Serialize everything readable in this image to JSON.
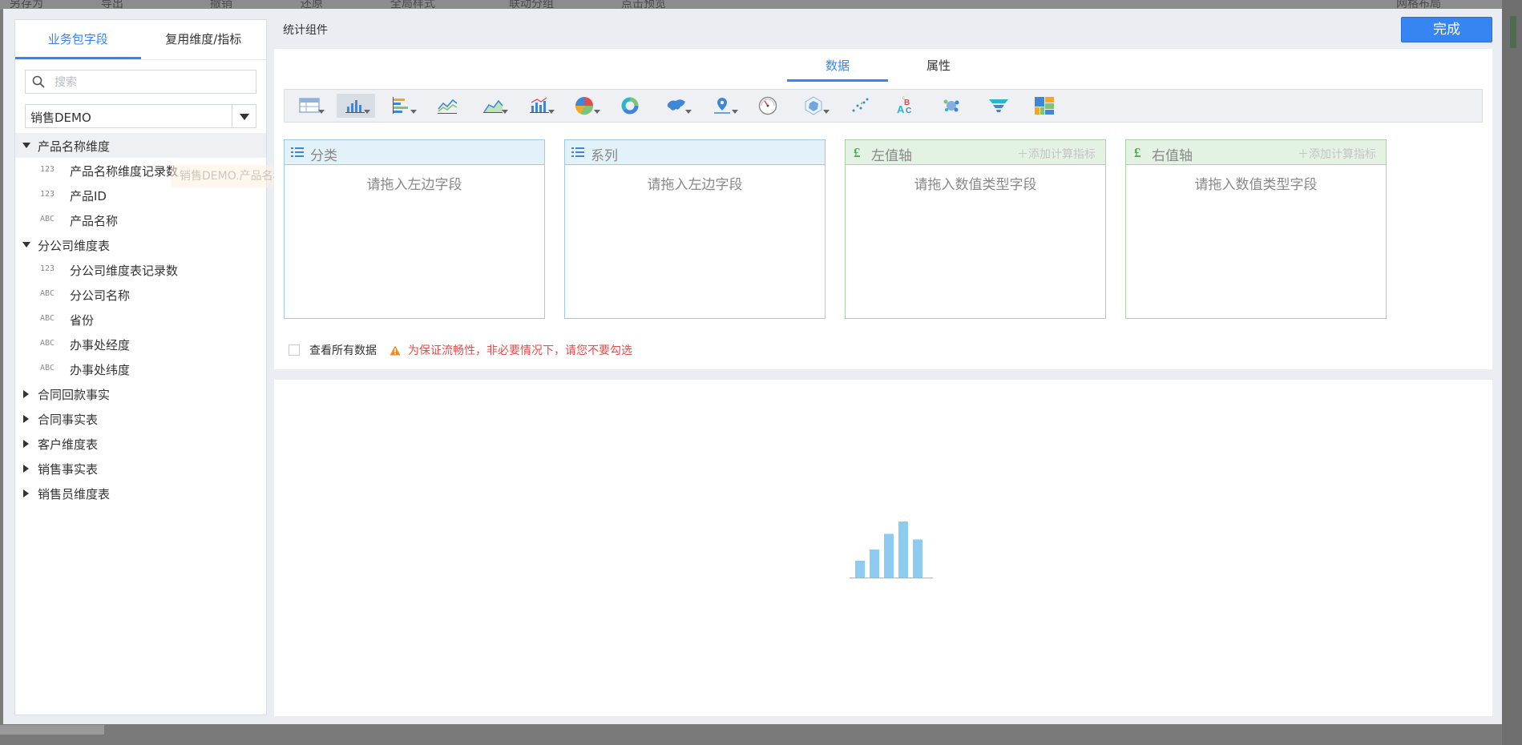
{
  "background_toolbar": [
    "另存为",
    "导出",
    "撤销",
    "还原",
    "全局样式",
    "联动分组",
    "点击预览",
    "网格布局"
  ],
  "left_panel": {
    "tabs": [
      {
        "label": "业务包字段",
        "active": true
      },
      {
        "label": "复用维度/指标",
        "active": false
      }
    ],
    "search_placeholder": "搜索",
    "package_select": "销售DEMO",
    "drag_ghost": "销售DEMO.产品名称维度",
    "tree": [
      {
        "label": "产品名称维度",
        "expanded": true,
        "highlighted": true,
        "fields": [
          {
            "type": "123",
            "label": "产品名称维度记录数"
          },
          {
            "type": "ABC",
            "label": "产品ID",
            "type_display": "123"
          },
          {
            "type": "ABC",
            "label": "产品名称"
          }
        ]
      },
      {
        "label": "分公司维度表",
        "expanded": true,
        "fields": [
          {
            "type": "123",
            "label": "分公司维度表记录数"
          },
          {
            "type": "ABC",
            "label": "分公司名称"
          },
          {
            "type": "ABC",
            "label": "省份"
          },
          {
            "type": "ABC",
            "label": "办事处经度"
          },
          {
            "type": "ABC",
            "label": "办事处纬度"
          }
        ]
      },
      {
        "label": "合同回款事实",
        "expanded": false
      },
      {
        "label": "合同事实表",
        "expanded": false
      },
      {
        "label": "客户维度表",
        "expanded": false
      },
      {
        "label": "销售事实表",
        "expanded": false
      },
      {
        "label": "销售员维度表",
        "expanded": false
      }
    ]
  },
  "widget_title": "统计组件",
  "done_button": "完成",
  "config_tabs": [
    {
      "label": "数据",
      "active": true
    },
    {
      "label": "属性",
      "active": false
    }
  ],
  "chart_types": [
    {
      "icon": "table-icon",
      "dropdown": true,
      "selected": false
    },
    {
      "icon": "bar-chart-icon",
      "dropdown": true,
      "selected": true
    },
    {
      "icon": "horizontal-bar-icon",
      "dropdown": true,
      "selected": false
    },
    {
      "icon": "line-chart-icon",
      "dropdown": false,
      "selected": false
    },
    {
      "icon": "area-chart-icon",
      "dropdown": true,
      "selected": false
    },
    {
      "icon": "combo-chart-icon",
      "dropdown": true,
      "selected": false
    },
    {
      "icon": "pie-chart-icon",
      "dropdown": true,
      "selected": false
    },
    {
      "icon": "donut-chart-icon",
      "dropdown": false,
      "selected": false
    },
    {
      "icon": "map-icon",
      "dropdown": true,
      "selected": false
    },
    {
      "icon": "location-map-icon",
      "dropdown": true,
      "selected": false
    },
    {
      "icon": "gauge-icon",
      "dropdown": false,
      "selected": false
    },
    {
      "icon": "radar-icon",
      "dropdown": true,
      "selected": false
    },
    {
      "icon": "scatter-icon",
      "dropdown": false,
      "selected": false
    },
    {
      "icon": "word-cloud-icon",
      "dropdown": false,
      "selected": false
    },
    {
      "icon": "force-bubble-icon",
      "dropdown": false,
      "selected": false
    },
    {
      "icon": "funnel-icon",
      "dropdown": false,
      "selected": false
    },
    {
      "icon": "treemap-icon",
      "dropdown": false,
      "selected": false
    }
  ],
  "regions": [
    {
      "title": "分类",
      "icon": "list-icon",
      "hint": "请拖入左边字段",
      "add_label": ""
    },
    {
      "title": "系列",
      "icon": "list-icon",
      "hint": "请拖入左边字段",
      "add_label": ""
    },
    {
      "title": "左值轴",
      "icon": "pound-icon",
      "hint": "请拖入数值类型字段",
      "add_label": "添加计算指标"
    },
    {
      "title": "右值轴",
      "icon": "pound-icon",
      "hint": "请拖入数值类型字段",
      "add_label": "添加计算指标"
    }
  ],
  "view_all": {
    "checked": false,
    "label": "查看所有数据",
    "warning": "为保证流畅性，非必要情况下，请您不要勾选"
  },
  "colors": {
    "accent": "#3685f2",
    "dimension_region": "#9fcbe8",
    "value_region": "#a8d5a8",
    "warning_text": "#e54b4b",
    "preview_bars": "#8fcaf0"
  },
  "preview_placeholder": {
    "icon": "empty-bar-chart-icon",
    "bar_levels": [
      0.3,
      0.5,
      0.78,
      1.0,
      0.68
    ]
  }
}
